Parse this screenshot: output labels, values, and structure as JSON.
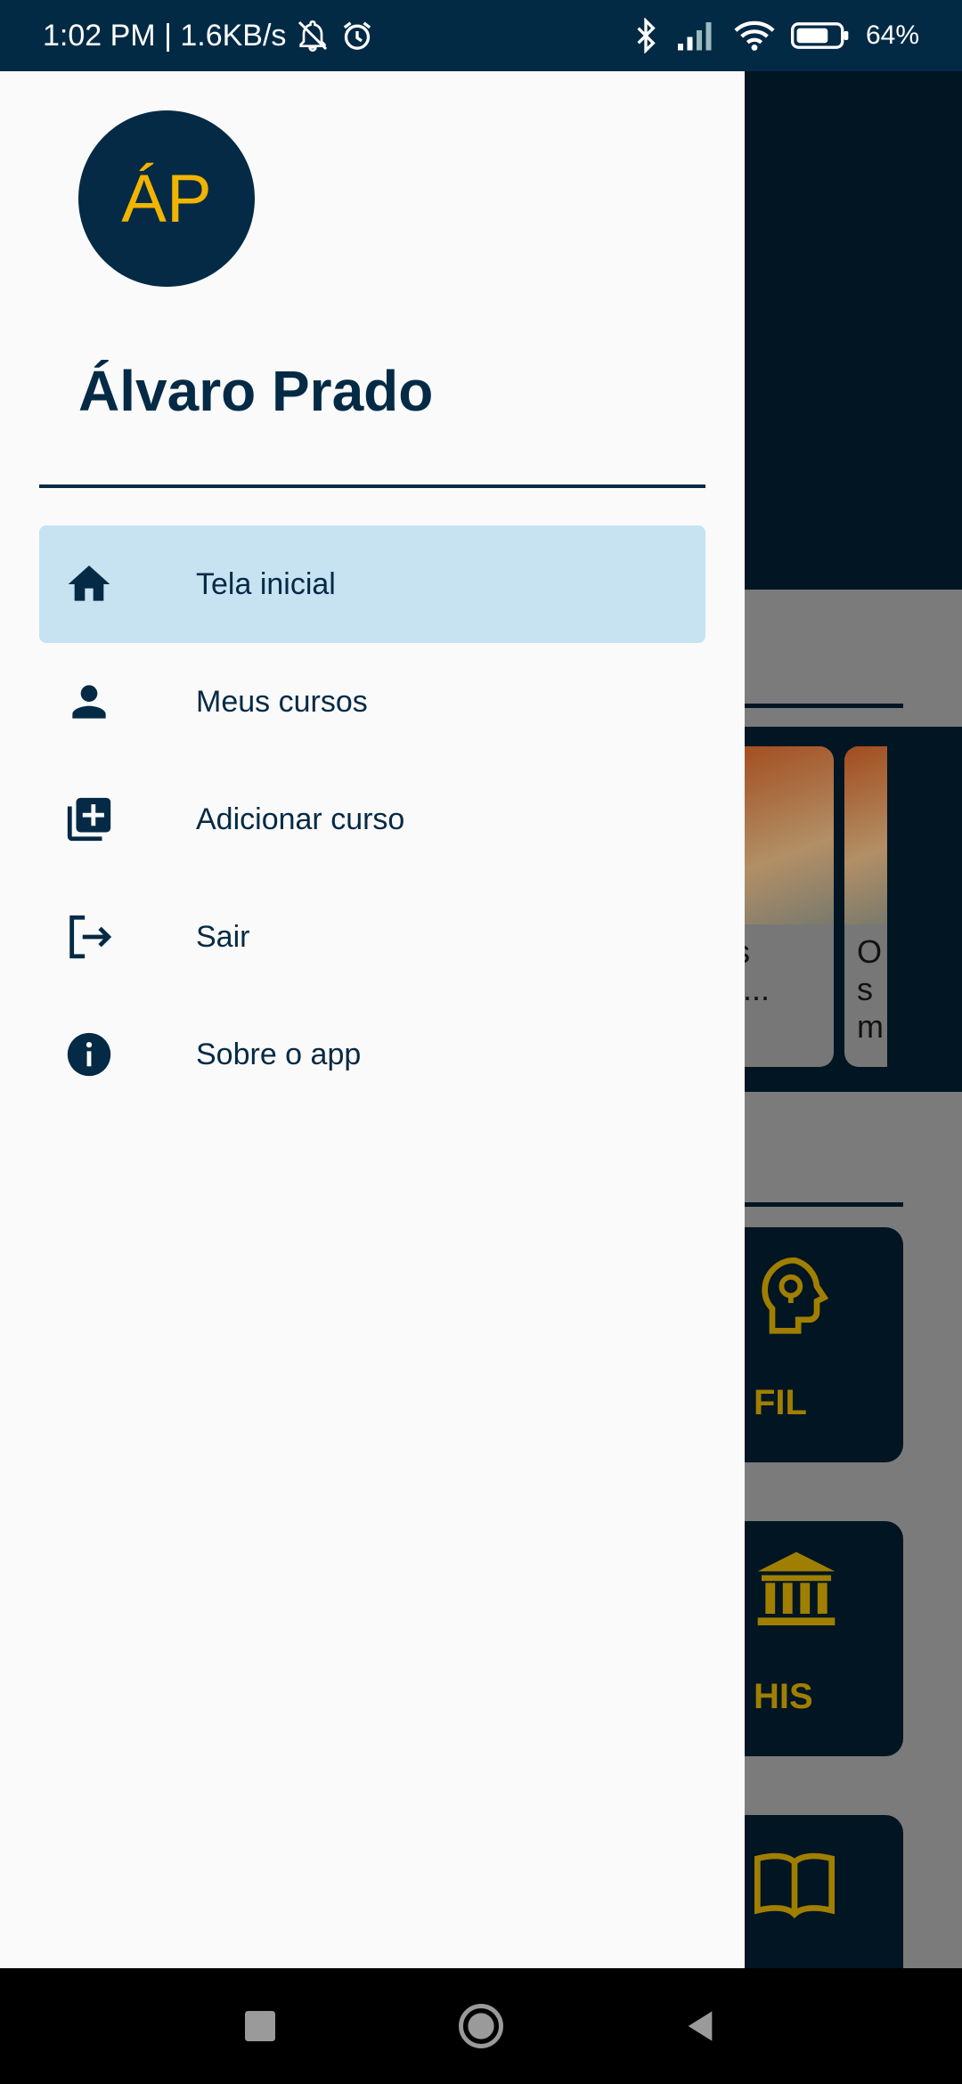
{
  "status_bar": {
    "time_speed": "1:02 PM | 1.6KB/s",
    "battery": "64%",
    "icons": [
      "mute-bell-icon",
      "alarm-icon",
      "bluetooth-icon",
      "signal-icon",
      "wifi-icon",
      "battery-icon"
    ]
  },
  "drawer": {
    "avatar_initials": "ÁP",
    "user_name": "Álvaro Prado",
    "items": [
      {
        "label": "Tela inicial",
        "icon": "home-icon",
        "active": true
      },
      {
        "label": "Meus cursos",
        "icon": "person-icon",
        "active": false
      },
      {
        "label": "Adicionar curso",
        "icon": "library-add-icon",
        "active": false
      },
      {
        "label": "Sair",
        "icon": "logout-icon",
        "active": false
      },
      {
        "label": "Sobre o app",
        "icon": "info-icon",
        "active": false
      }
    ]
  },
  "background": {
    "card_1_text": "s\nr...",
    "card_2_text": "O\ns\nm",
    "tiles": [
      {
        "label": "FIL",
        "icon": "head-bulb-icon"
      },
      {
        "label": "HIS",
        "icon": "museum-icon"
      },
      {
        "label": "",
        "icon": "book-icon"
      }
    ]
  },
  "colors": {
    "primary": "#052a45",
    "accent": "#f1b400",
    "active_item": "#c7e3f2",
    "drawer_bg": "#fafafa"
  },
  "nav_bar": {
    "icons": [
      "recents-icon",
      "home-circle-icon",
      "back-icon"
    ]
  }
}
